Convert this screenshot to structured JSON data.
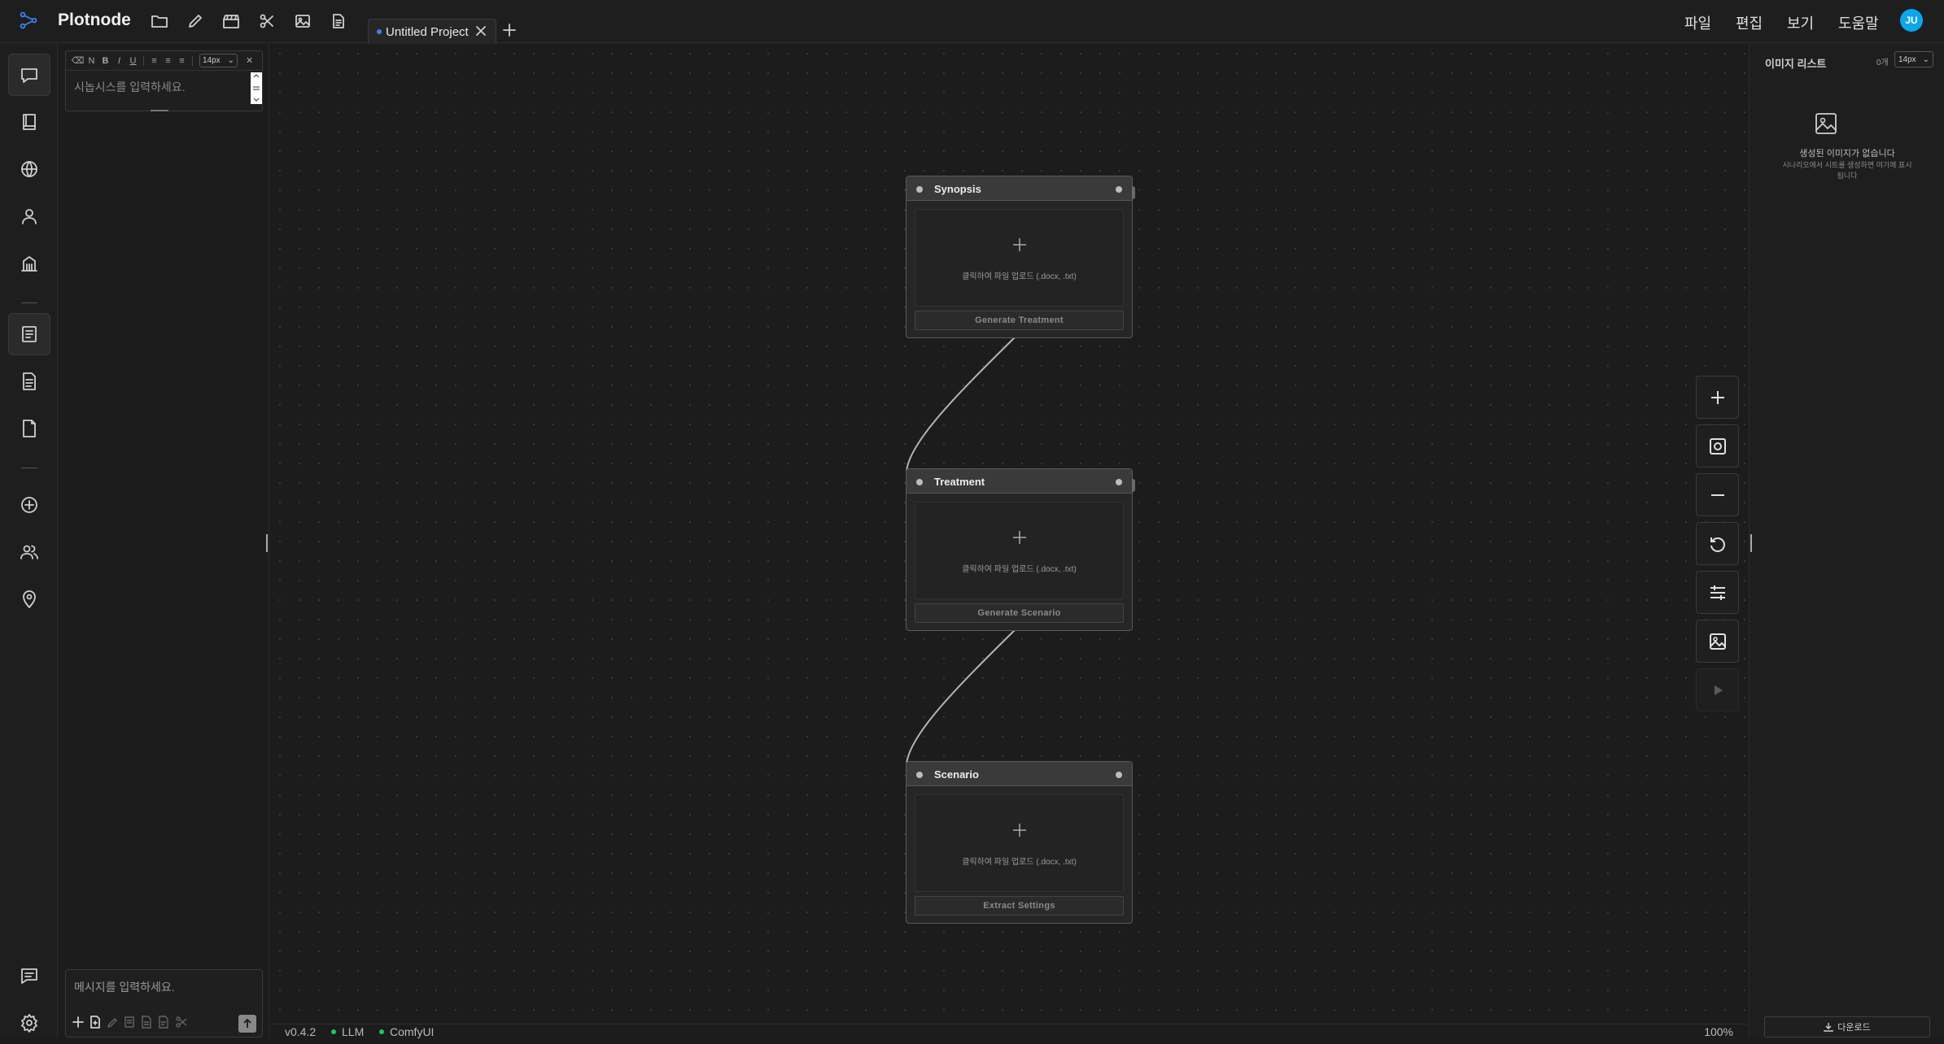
{
  "app": {
    "title": "Plotnode"
  },
  "tabs": [
    {
      "label": "Untitled Project"
    }
  ],
  "menu": {
    "file": "파일",
    "edit": "편집",
    "view": "보기",
    "help": "도움말"
  },
  "user": {
    "initials": "JU"
  },
  "editor": {
    "toolbar": {
      "normal": "N",
      "bold": "B",
      "italic": "I",
      "underline": "U",
      "font_size": "14px",
      "close": "✕"
    },
    "placeholder": "시놉시스를 입력하세요."
  },
  "chat": {
    "placeholder": "메시지를 입력하세요."
  },
  "nodes": [
    {
      "title": "Synopsis",
      "upload_label": "클릭하여 파일 업로드 (.docx, .txt)",
      "action_label": "Generate Treatment"
    },
    {
      "title": "Treatment",
      "upload_label": "클릭하여 파일 업로드 (.docx, .txt)",
      "action_label": "Generate Scenario"
    },
    {
      "title": "Scenario",
      "upload_label": "클릭하여 파일 업로드 (.docx, .txt)",
      "action_label": "Extract Settings"
    }
  ],
  "status": {
    "version": "v0.4.2",
    "llm": "LLM",
    "comfy": "ComfyUI",
    "zoom": "100%",
    "indicator_color": "#22c55e"
  },
  "image_list": {
    "title": "이미지 리스트",
    "count": "0개",
    "font_size": "14px",
    "empty_title": "생성된 이미지가 없습니다",
    "empty_desc": "시나리오에서 시트를 생성하면 여기에 표시됩니다",
    "download_label": "다운로드"
  },
  "colors": {
    "accent": "#3b82f6",
    "avatar": "#0ea5e9"
  }
}
